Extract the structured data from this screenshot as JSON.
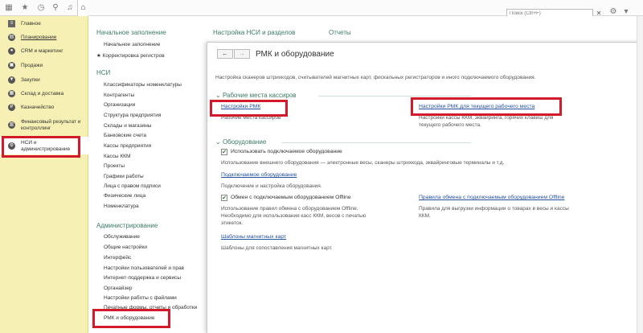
{
  "topbar": {
    "search_placeholder": "Поиск (Ctrl+F)",
    "home_icon": "home-icon",
    "icons": [
      "apps-grid-icon",
      "star-icon",
      "history-icon",
      "search-icon",
      "bell-icon"
    ]
  },
  "sidebar": {
    "items": [
      {
        "label": "Главное",
        "icon": "menu-icon"
      },
      {
        "label": "Планирование",
        "icon": "planning-icon"
      },
      {
        "label": "CRM и маркетинг",
        "icon": "crm-icon"
      },
      {
        "label": "Продажи",
        "icon": "sales-icon"
      },
      {
        "label": "Закупки",
        "icon": "purchases-icon"
      },
      {
        "label": "Склад и доставка",
        "icon": "warehouse-icon"
      },
      {
        "label": "Казначейство",
        "icon": "treasury-icon"
      },
      {
        "label": "Финансовый результат и контроллинг",
        "icon": "finance-icon"
      },
      {
        "label": "НСИ и администрирование",
        "icon": "gear-icon"
      }
    ]
  },
  "panel": {
    "col1": {
      "head1": "Начальное заполнение",
      "links1": [
        "Начальное заполнение",
        "Корректировка регистров"
      ],
      "head2": "НСИ",
      "links2": [
        "Классификаторы номенклатуры",
        "Контрагенты",
        "Организации",
        "Структура предприятия",
        "Склады и магазины",
        "Банковские счета",
        "Кассы предприятия",
        "Кассы ККМ",
        "Проекты",
        "Графики работы",
        "Лица с правом подписи",
        "Физические лица",
        "Номенклатура"
      ],
      "head3": "Администрирование",
      "links3": [
        "Обслуживание",
        "Общие настройки",
        "Интерфейс",
        "Настройки пользователей и прав",
        "Интернет-поддержка и сервисы",
        "Органайзер",
        "Настройки работы с файлами",
        "Печатные формы, отчеты и обработки",
        "РМК и оборудование"
      ]
    },
    "col2_head": "Настройка НСИ и разделов",
    "col3_head": "Отчеты"
  },
  "form": {
    "back": "←",
    "forward": "→",
    "title": "РМК и оборудование",
    "intro": "Настройка сканеров штрихкодов, считывателей магнитных карт, фискальных регистраторов и иного подключаемого оборудования.",
    "group1": "Рабочие места кассиров",
    "rmk_link": "Настройки РМК",
    "rmk_desc": "Рабочие места кассиров",
    "rmk_cur_link": "Настройки РМК для текущего рабочего места",
    "rmk_cur_desc1": "Настройки кассы ККМ, эквайринга, горячих клавиш для",
    "rmk_cur_desc2": "текущего рабочего места.",
    "group2": "Оборудование",
    "use_equipment": "Использовать подключаемое оборудование",
    "use_equipment_desc": "Использование внешнего оборудования — электронные весы, сканеры штрихкода, эквайринговые терминалы и т.д.",
    "equip_link": "Подключаемое оборудование",
    "equip_desc": "Подключение и настройка оборудования.",
    "offline_label": "Обмен с подключаемым оборудованием Offline",
    "offline_desc1": "Использование правил обмена с оборудованием Offline.",
    "offline_desc2": "Необходимо для использования касс ККМ, весов с печатью",
    "offline_desc3": "этикеток.",
    "offline_rules_link": "Правила обмена с подключаемым оборудованием Offline",
    "offline_rules_desc1": "Правила для выгрузки информации о товарах в весы и кассы",
    "offline_rules_desc2": "ККМ.",
    "mag_link": "Шаблоны магнитных карт",
    "mag_desc": "Шаблоны для сопоставления магнитных карт."
  },
  "colors": {
    "sidebar_bg": "#f7f0b4",
    "heading_green": "#3c7a66",
    "link_blue": "#2550a0",
    "highlight_red": "#d21a2a"
  }
}
